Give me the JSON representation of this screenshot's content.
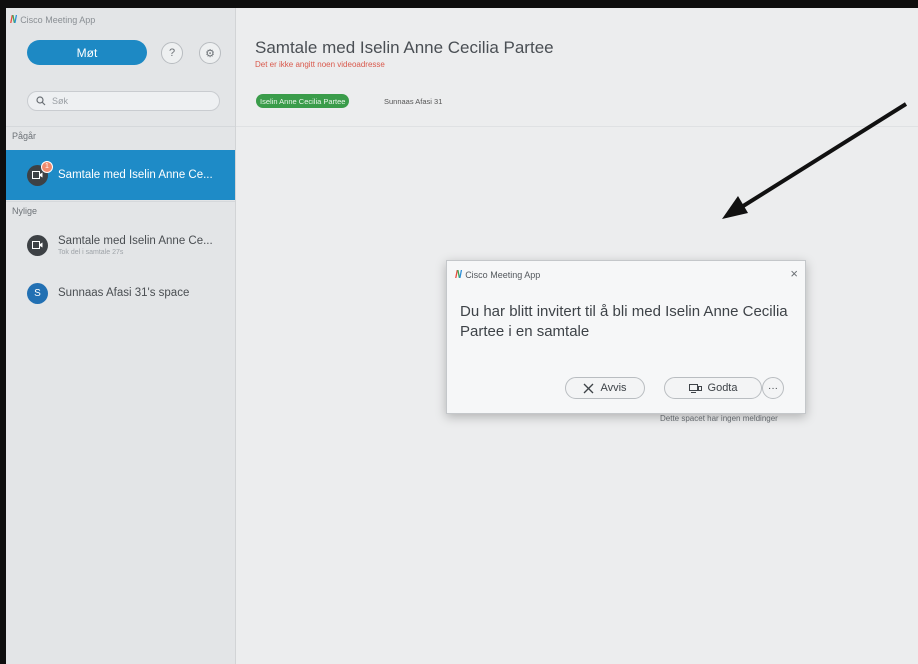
{
  "app": {
    "title": "Cisco Meeting App"
  },
  "sidebar": {
    "meet_label": "Møt",
    "help_icon": "question-circle-icon",
    "settings_icon": "gear-icon",
    "search_placeholder": "Søk",
    "section_ongoing": "Pågår",
    "section_recent": "Nylige",
    "ongoing": [
      {
        "title": "Samtale med Iselin Anne Ce...",
        "badge": "1",
        "icon": "video-icon"
      }
    ],
    "recent": [
      {
        "title": "Samtale med Iselin Anne Ce...",
        "subtitle": "Tok del i samtale 27s",
        "icon": "video-icon"
      },
      {
        "title": "Sunnaas Afasi 31's space",
        "avatar_letter": "S"
      }
    ]
  },
  "main": {
    "title": "Samtale med Iselin Anne Cecilia Partee",
    "subtitle": "Det er ikke angitt noen videoadresse",
    "participants": [
      "Iselin Anne Cecilia Partee",
      "Sunnaas Afasi 31"
    ],
    "empty_message": "Dette spacet har ingen meldinger"
  },
  "dialog": {
    "title": "Cisco Meeting App",
    "message": "Du har blitt invitert til å bli med Iselin Anne Cecilia Partee i en samtale",
    "reject_label": "Avvis",
    "accept_label": "Godta",
    "more_label": "···"
  },
  "colors": {
    "accent": "#1e8bc7",
    "participant_chip": "#3a9c4a",
    "warning_text": "#d9594c"
  }
}
